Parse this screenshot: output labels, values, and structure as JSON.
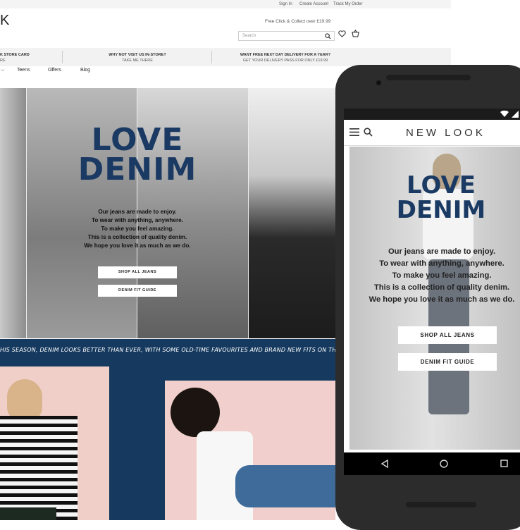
{
  "desktop": {
    "utility_links": [
      "Sign In",
      "Create Account",
      "Track My Order"
    ],
    "logo_fragment": "K",
    "nav": [
      "Teens",
      "Offers",
      "Blog"
    ],
    "collect_text": "Free Click & Collect over £19.99",
    "search_placeholder": "Search",
    "promo": [
      {
        "title": "K STORE CARD",
        "sub": "RE"
      },
      {
        "title": "WHY NOT VISIT US IN-STORE?",
        "sub": "TAKE ME THERE"
      },
      {
        "title": "WANT FREE NEXT DAY DELIVERY FOR A YEAR?",
        "sub": "GET YOUR DELIVERY PASS FOR ONLY £19.99"
      }
    ],
    "hero": {
      "title_line1": "LOVE",
      "title_line2": "DENIM",
      "copy": [
        "Our jeans are made to enjoy.",
        "To wear with anything, anywhere.",
        "To make you feel amazing.",
        "This is a collection of quality denim.",
        "We hope you love it as much as we do."
      ],
      "btn_shop": "SHOP ALL JEANS",
      "btn_fit": "DENIM FIT GUIDE"
    },
    "band_text": "HIS SEASON, DENIM LOOKS BETTER THAN EVER, WITH SOME OLD-TIME FAVOURITES AND BRAND NEW FITS ON THE SCENE."
  },
  "mobile": {
    "logo": "NEW LOOK",
    "hero": {
      "title_line1": "LOVE",
      "title_line2": "DENIM",
      "copy": [
        "Our jeans are made to enjoy.",
        "To wear with anything, anywhere.",
        "To make you feel amazing.",
        "This is a collection of quality denim.",
        "We hope you love it as much as we do."
      ],
      "btn_shop": "SHOP ALL JEANS",
      "btn_fit": "DENIM FIT GUIDE"
    }
  },
  "colors": {
    "brand_navy": "#1b3a63",
    "band_navy": "#163a5f",
    "pink": "#f0cfc9"
  }
}
